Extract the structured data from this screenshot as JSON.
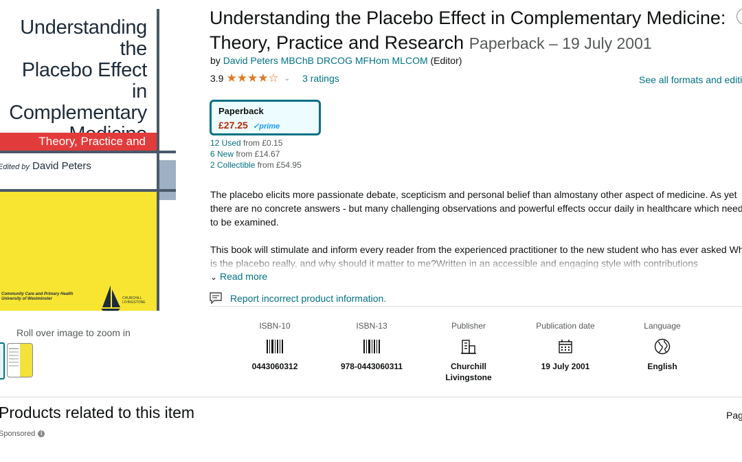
{
  "cover": {
    "title_lines": [
      "Understanding the",
      "Placebo Effect",
      "in",
      "Complementary",
      "Medicine"
    ],
    "subtitle": "Theory, Practice and Research",
    "editor_prefix": "Edited by",
    "editor": "David Peters",
    "series_lines": [
      "Community Care and Primary Health",
      "University of Westminster"
    ],
    "publisher_lines": [
      "CHURCHILL",
      "LIVINGSTONE"
    ],
    "colors": {
      "band": "#e23b3b",
      "yellow": "#f7e531",
      "navy": "#1d2b3a",
      "slate": "#9eb0c3"
    }
  },
  "gallery": {
    "zoom_hint": "Roll over image to zoom in"
  },
  "product": {
    "title": "Understanding the Placebo Effect in Complementary Medicine: Theory, Practice and Research",
    "format_date": "Paperback – 19 July 2001",
    "by_prefix": "by",
    "author": "David Peters MBChB DRCOG MFHom MLCOM",
    "author_role": "(Editor)",
    "rating_value": "3.9",
    "stars_icon": "star-rating-icon",
    "rating_stars": 3.9,
    "ratings_count": "3 ratings",
    "see_all_formats": "See all formats and editions"
  },
  "format_box": {
    "label": "Paperback",
    "price": "£27.25",
    "prime": "prime"
  },
  "offers": [
    {
      "link": "12 Used",
      "rest": " from £0.15"
    },
    {
      "link": "6 New",
      "rest": " from £14.67"
    },
    {
      "link": "2 Collectible",
      "rest": " from £54.95"
    }
  ],
  "description": {
    "p1": "The placebo elicits more passionate debate, scepticism and personal belief than almostany other aspect of medicine. As yet there are no concrete answers - but many challenging observations and powerful effects occur daily in healthcare which need to be examined.",
    "p2": "This book will stimulate and inform every reader from the experienced practitioner to the new student who has ever asked What is the placebo really, and why should it matter to me?Written in an accessible and engaging style with contributions",
    "read_more": "Read more"
  },
  "report": {
    "label": "Report incorrect product information."
  },
  "attributes": [
    {
      "name": "isbn10",
      "label": "ISBN-10",
      "icon": "barcode-icon",
      "value": "0443060312"
    },
    {
      "name": "isbn13",
      "label": "ISBN-13",
      "icon": "barcode-icon",
      "value": "978-0443060311"
    },
    {
      "name": "publisher",
      "label": "Publisher",
      "icon": "building-icon",
      "value": "Churchill Livingstone"
    },
    {
      "name": "pubdate",
      "label": "Publication date",
      "icon": "calendar-icon",
      "value": "19 July 2001"
    },
    {
      "name": "language",
      "label": "Language",
      "icon": "globe-icon",
      "value": "English"
    }
  ],
  "related": {
    "heading": "Products related to this item",
    "sponsored": "Sponsored",
    "page": "Page"
  },
  "colors": {
    "link": "#007185",
    "price": "#b12704",
    "star": "#de7921",
    "prime": "#1a98ff"
  }
}
